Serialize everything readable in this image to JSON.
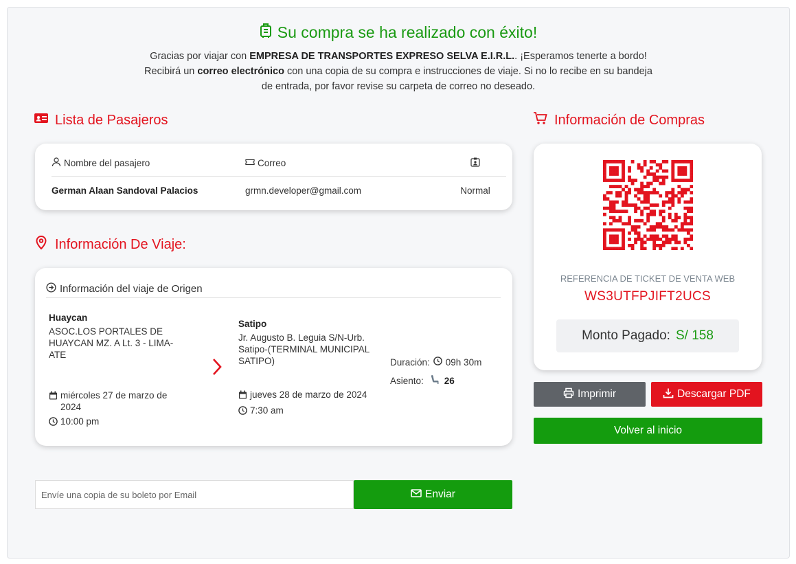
{
  "header": {
    "title": "Su compra se ha realizado con éxito!",
    "msg_part1": "Gracias por viajar con ",
    "company": "EMPRESA DE TRANSPORTES EXPRESO SELVA E.I.R.L.",
    "msg_part2": ". ¡Esperamos tenerte a bordo! Recibirá un ",
    "email_bold": "correo electrónico",
    "msg_part3": " con una copia de su compra e instrucciones de viaje. Si no lo recibe en su bandeja de entrada, por favor revise su carpeta de correo no deseado."
  },
  "passengers": {
    "title": "Lista de Pasajeros",
    "col_name": "Nombre del pasajero",
    "col_email": "Correo",
    "rows": [
      {
        "name": "German Alaan Sandoval Palacios",
        "email": "grmn.developer@gmail.com",
        "type": "Normal"
      }
    ]
  },
  "trip": {
    "title": "Información De Viaje:",
    "subtitle": "Información del viaje de Origen",
    "origin": {
      "city": "Huaycan",
      "address": "ASOC.LOS PORTALES DE HUAYCAN MZ. A Lt. 3 - LIMA-ATE",
      "date": "miércoles 27 de marzo de 2024",
      "time": "10:00 pm"
    },
    "destination": {
      "city": "Satipo",
      "address": "Jr. Augusto B. Leguia S/N-Urb. Satipo-(TERMINAL MUNICIPAL SATIPO)",
      "date": "jueves 28 de marzo de 2024",
      "time": "7:30 am"
    },
    "duration_label": "Duración:",
    "duration": "09h 30m",
    "seat_label": "Asiento:",
    "seat": "26"
  },
  "email_form": {
    "placeholder": "Envíe una copia de su boleto por Email",
    "send_label": "Enviar"
  },
  "purchase": {
    "title": "Información de Compras",
    "ref_label": "REFERENCIA DE TICKET DE VENTA WEB",
    "ref_code": "WS3UTFPJIFT2UCS",
    "amount_label": "Monto Pagado:",
    "amount_value": "S/ 158",
    "print_label": "Imprimir",
    "pdf_label": "Descargar PDF",
    "home_label": "Volver al inicio"
  },
  "colors": {
    "accent_red": "#e3141f",
    "success_green": "#1a9a12",
    "button_green": "#149c0e",
    "button_gray": "#5f6368"
  },
  "icons": [
    "luggage-icon",
    "id-card-icon",
    "user-icon",
    "ticket-icon",
    "badge-icon",
    "location-pin-icon",
    "arrow-circle-right-icon",
    "calendar-icon",
    "clock-icon",
    "chevron-right-icon",
    "seat-icon",
    "envelope-icon",
    "cart-icon",
    "qr-code",
    "printer-icon",
    "download-icon"
  ]
}
